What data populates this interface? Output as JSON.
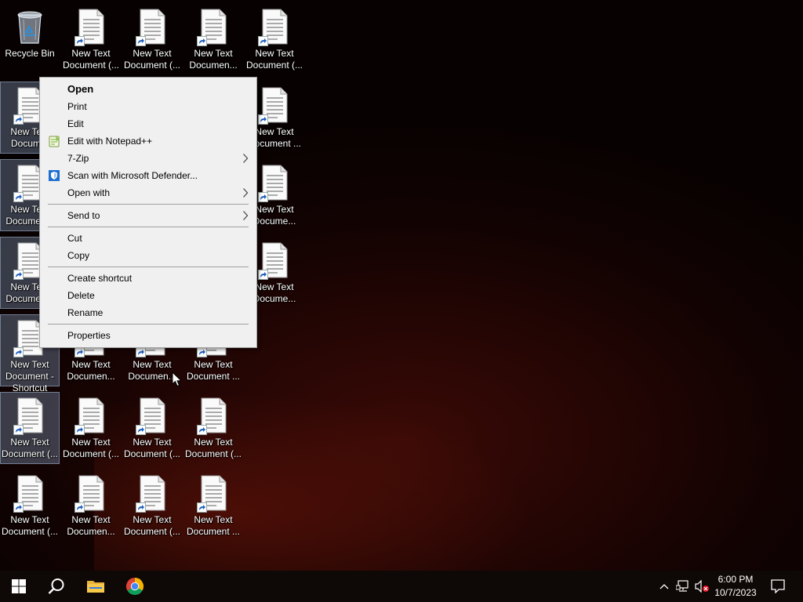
{
  "desktop": {
    "icons": [
      {
        "id": "recycle-bin",
        "label": "Recycle Bin",
        "type": "recycle",
        "col": 0,
        "row": 0
      },
      {
        "id": "doc-0-1",
        "label": "New Text Document (...",
        "type": "doc",
        "col": 1,
        "row": 0
      },
      {
        "id": "doc-0-2",
        "label": "New Text Document (...",
        "type": "doc",
        "col": 2,
        "row": 0
      },
      {
        "id": "doc-0-3",
        "label": "New Text Documen...",
        "type": "doc",
        "col": 3,
        "row": 0
      },
      {
        "id": "doc-0-4",
        "label": "New Text Document (...",
        "type": "doc",
        "col": 4,
        "row": 0
      },
      {
        "id": "doc-1-0",
        "label": "New Text Docum...",
        "type": "doc",
        "col": 0,
        "row": 1,
        "selected": true
      },
      {
        "id": "doc-1-4",
        "label": "New Text Document ...",
        "type": "doc",
        "col": 4,
        "row": 1
      },
      {
        "id": "doc-2-0",
        "label": "New Text Documen...",
        "type": "doc",
        "col": 0,
        "row": 2,
        "selected": true
      },
      {
        "id": "doc-2-4",
        "label": "New Text Docume...",
        "type": "doc",
        "col": 4,
        "row": 2
      },
      {
        "id": "doc-3-0",
        "label": "New Text Documen...",
        "type": "doc",
        "col": 0,
        "row": 3,
        "selected": true
      },
      {
        "id": "doc-3-4",
        "label": "New Text Docume...",
        "type": "doc",
        "col": 4,
        "row": 3
      },
      {
        "id": "doc-4-0",
        "label": "New Text Document - Shortcut",
        "type": "doc",
        "col": 0,
        "row": 4,
        "selected": true
      },
      {
        "id": "doc-4-1",
        "label": "New Text Documen...",
        "type": "doc",
        "col": 1,
        "row": 4
      },
      {
        "id": "doc-4-2",
        "label": "New Text Documen...",
        "type": "doc",
        "col": 2,
        "row": 4
      },
      {
        "id": "doc-4-3",
        "label": "New Text Document ...",
        "type": "doc",
        "col": 3,
        "row": 4
      },
      {
        "id": "doc-5-0",
        "label": "New Text Document (...",
        "type": "doc",
        "col": 0,
        "row": 5,
        "selected": true
      },
      {
        "id": "doc-5-1",
        "label": "New Text Document (...",
        "type": "doc",
        "col": 1,
        "row": 5
      },
      {
        "id": "doc-5-2",
        "label": "New Text Document (...",
        "type": "doc",
        "col": 2,
        "row": 5
      },
      {
        "id": "doc-5-3",
        "label": "New Text Document (...",
        "type": "doc",
        "col": 3,
        "row": 5
      },
      {
        "id": "doc-6-0",
        "label": "New Text Document (...",
        "type": "doc",
        "col": 0,
        "row": 6
      },
      {
        "id": "doc-6-1",
        "label": "New Text Documen...",
        "type": "doc",
        "col": 1,
        "row": 6
      },
      {
        "id": "doc-6-2",
        "label": "New Text Document (...",
        "type": "doc",
        "col": 2,
        "row": 6
      },
      {
        "id": "doc-6-3",
        "label": "New Text Document ...",
        "type": "doc",
        "col": 3,
        "row": 6
      }
    ]
  },
  "context_menu": {
    "items": [
      {
        "name": "open",
        "label": "Open",
        "bold": true
      },
      {
        "name": "print",
        "label": "Print"
      },
      {
        "name": "edit",
        "label": "Edit"
      },
      {
        "name": "edit-with-notepadpp",
        "label": "Edit with Notepad++",
        "icon": "notepadpp-icon"
      },
      {
        "name": "7zip",
        "label": "7-Zip",
        "submenu": true
      },
      {
        "name": "scan-with-defender",
        "label": "Scan with Microsoft Defender...",
        "icon": "defender-shield-icon"
      },
      {
        "name": "open-with",
        "label": "Open with",
        "submenu": true
      },
      {
        "separator": true
      },
      {
        "name": "send-to",
        "label": "Send to",
        "submenu": true
      },
      {
        "separator": true
      },
      {
        "name": "cut",
        "label": "Cut"
      },
      {
        "name": "copy",
        "label": "Copy"
      },
      {
        "separator": true
      },
      {
        "name": "create-shortcut",
        "label": "Create shortcut"
      },
      {
        "name": "delete",
        "label": "Delete"
      },
      {
        "name": "rename",
        "label": "Rename"
      },
      {
        "separator": true
      },
      {
        "name": "properties",
        "label": "Properties"
      }
    ]
  },
  "taskbar": {
    "start_icon": "windows-logo-icon",
    "search_icon": "search-icon",
    "pinned": [
      {
        "name": "file-explorer",
        "icon": "folder-icon"
      },
      {
        "name": "chrome",
        "icon": "chrome-icon"
      }
    ],
    "tray": {
      "icons": [
        "chevron-up-icon",
        "network-icon",
        "speaker-muted-icon"
      ],
      "time": "6:00 PM",
      "date": "10/7/2023",
      "notifications_icon": "notification-icon"
    }
  },
  "colors": {
    "selection": "#7a8caa",
    "menu_bg": "#f0f0f0",
    "taskbar_bg": "#0e0806",
    "notepadpp_green": "#8bc34a",
    "defender_blue": "#1f6fd1",
    "chrome_red": "#db4437",
    "chrome_yellow": "#f4b400",
    "chrome_green": "#0f9d58",
    "chrome_blue": "#4285f4",
    "folder_yellow": "#e8b03c"
  }
}
